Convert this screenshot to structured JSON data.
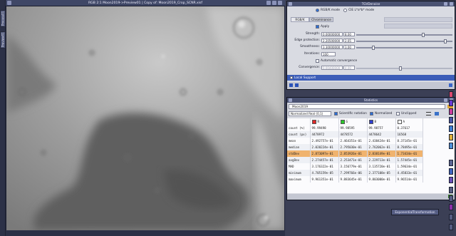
{
  "left_tabs": [
    "Process01",
    "Preview01"
  ],
  "image_window": {
    "title": "RGB 2:1 Moon2019->Preview01 | Copy of: Moon2019_Crop_SCNR.xisf"
  },
  "tgv": {
    "title": "TGVDenoise",
    "mode_rgbk": "RGB/K mode",
    "mode_cie": "CIE L*a*b* mode",
    "tabs": [
      "RGB/K",
      "Chrominance"
    ],
    "apply_label": "Apply",
    "params": [
      {
        "label": "Strength:",
        "value": "0.00000000",
        "short": "8.00"
      },
      {
        "label": "Edge protection:",
        "value": "2.20500000",
        "short": "2.05"
      },
      {
        "label": "Smoothness:",
        "value": "3.30000000",
        "short": "3.00"
      }
    ],
    "iterations_label": "Iterations:",
    "iterations_value": "100",
    "auto_convergence": "Automatic convergence",
    "convergence_label": "Convergence:",
    "convergence_value": "0.00400000",
    "convergence_short": "4.00",
    "local_support": "Local Support"
  },
  "statistics": {
    "title": "Statistics",
    "image_select": "Moon2019",
    "range_select": "Normalized Real (0,1)",
    "scientific": "Scientific notation",
    "normalized": "Normalized",
    "unclipped": "Unclipped",
    "channel_headers": [
      "R",
      "G",
      "B",
      "A"
    ],
    "channel_colors": [
      "#e02828",
      "#2bc72b",
      "#2f3ed0",
      "#ffffff"
    ],
    "rows": [
      {
        "name": "count (%)",
        "values": [
          "99.99498",
          "99.98595",
          "99.98757",
          "0.37617"
        ]
      },
      {
        "name": "count (px)",
        "values": [
          "4478972",
          "4478572",
          "4478642",
          "16568"
        ]
      },
      {
        "name": "mean",
        "values": [
          "2.492757e-01",
          "2.464351e-01",
          "2.438424e-01",
          "8.37145e-01"
        ]
      },
      {
        "name": "median",
        "values": [
          "2.020224e-01",
          "2.795030e-01",
          "2.762062e-01",
          "8.78495e-01"
        ]
      },
      {
        "name": "stdDev",
        "values": [
          "2.873097e-01",
          "2.853926e-01",
          "2.838149e-01",
          "1.73434e-01"
        ]
      },
      {
        "name": "avgDev",
        "values": [
          "2.274457e-01",
          "2.253471e-01",
          "2.229713e-01",
          "1.57445e-01"
        ]
      },
      {
        "name": "MAD",
        "values": [
          "3.176322e-01",
          "3.156779e-01",
          "3.135720e-01",
          "1.59634e-01"
        ]
      },
      {
        "name": "minimum",
        "values": [
          "4.705159e-05",
          "7.299766e-06",
          "2.377108e-05",
          "4.45833e-01"
        ]
      },
      {
        "name": "maximum",
        "values": [
          "9.961351e-01",
          "9.883645e-01",
          "9.803000e-01",
          "9.96514e-01"
        ]
      }
    ]
  },
  "exp_button": "ExponentialTransformation"
}
